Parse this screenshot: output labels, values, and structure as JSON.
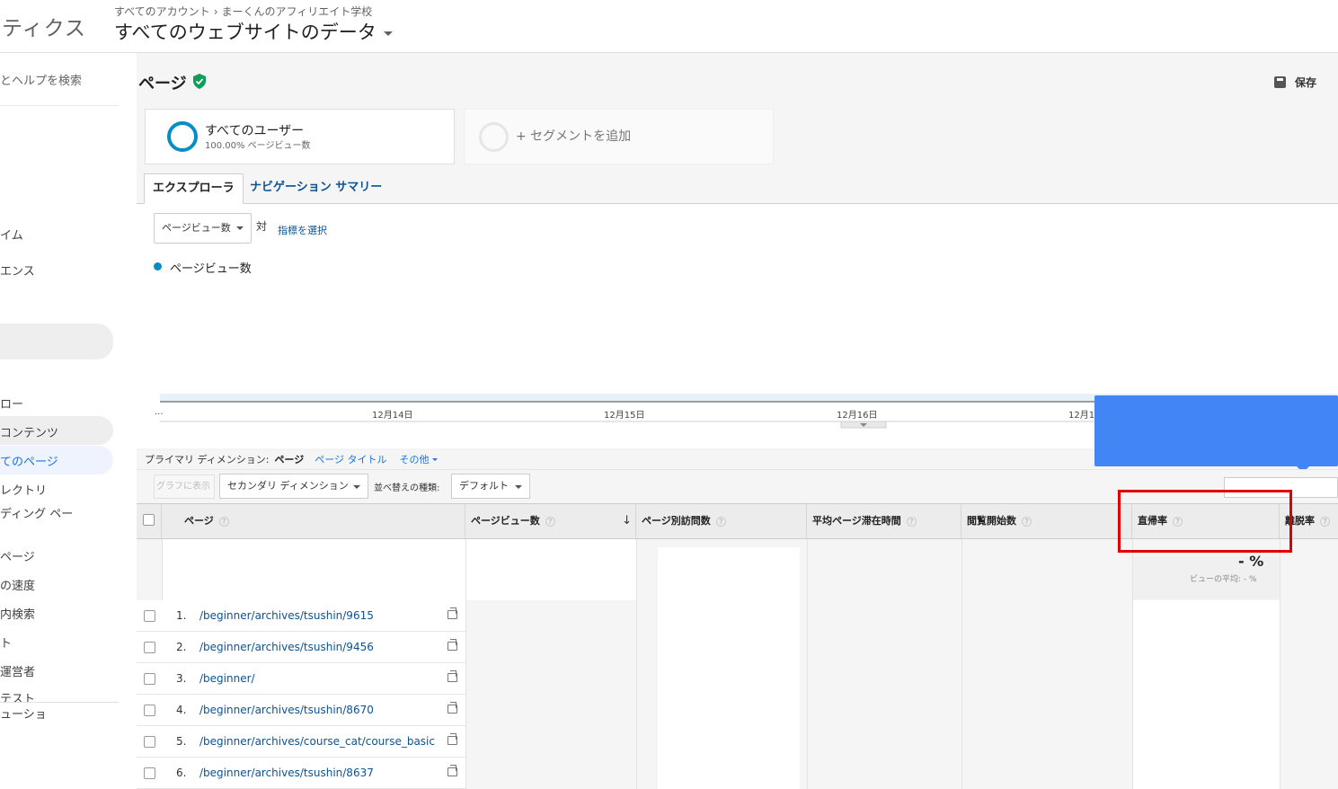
{
  "header": {
    "app_name": "ティクス",
    "breadcrumb_account": "すべてのアカウント",
    "breadcrumb_property": "まーくんのアフィリエイト学校",
    "view_name": "すべてのウェブサイトのデータ"
  },
  "sidebar": {
    "search_help": "とヘルプを検索",
    "items": [
      "イム",
      "エンス",
      "ロー",
      "コンテンツ",
      "てのページ",
      "レクトリ",
      "ディング ペー",
      "ページ",
      "の速度",
      "内検索",
      "ト",
      "運営者",
      "テスト",
      "ューショ"
    ]
  },
  "report": {
    "title": "ページ",
    "save_label": "保存"
  },
  "segments": {
    "all_users": "すべてのユーザー",
    "all_users_sub": "100.00% ページビュー数",
    "add_segment": "+ セグメントを追加"
  },
  "tabs": {
    "explorer": "エクスプローラ",
    "navigation": "ナビゲーション サマリー"
  },
  "chart_controls": {
    "metric": "ページビュー数",
    "vs": "対",
    "pick_metric": "指標を選択",
    "legend": "ページビュー数"
  },
  "chart_data": {
    "type": "line",
    "categories": [
      "...",
      "12月14日",
      "12月15日",
      "12月16日",
      "12月1"
    ],
    "series": [
      {
        "name": "ページビュー数",
        "values": []
      }
    ],
    "title": "",
    "xlabel": "",
    "ylabel": ""
  },
  "dimensions": {
    "label": "プライマリ ディメンション:",
    "current": "ページ",
    "page_title": "ページ タイトル",
    "other": "その他"
  },
  "toolbar": {
    "graph_button": "グラフに表示",
    "secondary_dimension": "セカンダリ ディメンション",
    "sort_label": "並べ替えの種類:",
    "sort_value": "デフォルト"
  },
  "table": {
    "columns": [
      "ページ",
      "ページビュー数",
      "ページ別訪問数",
      "平均ページ滞在時間",
      "閲覧開始数",
      "直帰率",
      "離脱率"
    ],
    "help": "?",
    "bounce_summary": "- %",
    "bounce_summary_sub": "ビューの平均: - %",
    "rows": [
      {
        "index": "1.",
        "path": "/beginner/archives/tsushin/9615"
      },
      {
        "index": "2.",
        "path": "/beginner/archives/tsushin/9456"
      },
      {
        "index": "3.",
        "path": "/beginner/"
      },
      {
        "index": "4.",
        "path": "/beginner/archives/tsushin/8670"
      },
      {
        "index": "5.",
        "path": "/beginner/archives/course_cat/course_basic"
      },
      {
        "index": "6.",
        "path": "/beginner/archives/tsushin/8637"
      }
    ]
  },
  "colors": {
    "accent": "#058dc7",
    "link": "#0b5394",
    "tooltip": "#4285f4",
    "highlight": "#e00000"
  }
}
